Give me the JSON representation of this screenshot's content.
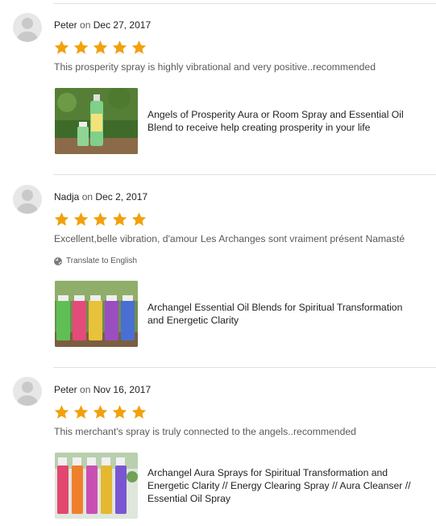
{
  "reviews": [
    {
      "reviewer": "Peter",
      "date": "Dec 27, 2017",
      "rating": 5,
      "text": "This prosperity spray is highly vibrational and very positive..recommended",
      "translate_label": "",
      "listing_title": "Angels of Prosperity Aura or Room Spray and Essential Oil Blend to receive help creating prosperity in your life"
    },
    {
      "reviewer": "Nadja",
      "date": "Dec 2, 2017",
      "rating": 5,
      "text": "Excellent,belle vibration, d'amour Les Archanges sont vraiment présent Namasté",
      "translate_label": "Translate to English",
      "listing_title": "Archangel Essential Oil Blends for Spiritual Transformation and Energetic Clarity"
    },
    {
      "reviewer": "Peter",
      "date": "Nov 16, 2017",
      "rating": 5,
      "text": "This merchant's spray is truly connected to the angels..recommended",
      "translate_label": "",
      "listing_title": "Archangel Aura Sprays for Spiritual Transformation and Energetic Clarity // Energy Clearing Spray // Aura Cleanser // Essential Oil Spray"
    }
  ],
  "labels": {
    "on": "on"
  },
  "colors": {
    "star": "#F1A10D",
    "text_muted": "#595959",
    "divider": "#E1E1E1"
  }
}
